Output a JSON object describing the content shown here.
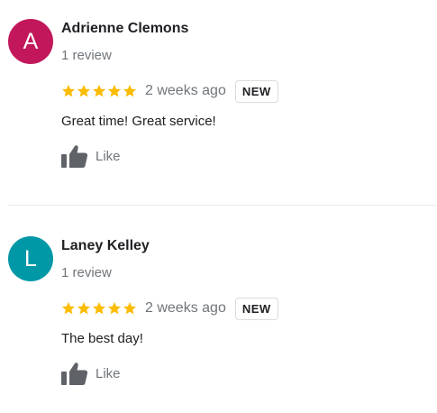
{
  "reviews": [
    {
      "avatar_letter": "A",
      "avatar_color": "#c2185b",
      "name": "Adrienne Clemons",
      "review_count": "1 review",
      "rating": 5,
      "time": "2 weeks ago",
      "badge": "NEW",
      "text": "Great time! Great service!",
      "like_label": "Like"
    },
    {
      "avatar_letter": "L",
      "avatar_color": "#0097a7",
      "name": "Laney Kelley",
      "review_count": "1 review",
      "rating": 5,
      "time": "2 weeks ago",
      "badge": "NEW",
      "text": "The best day!",
      "like_label": "Like"
    }
  ],
  "colors": {
    "star": "#fbbc04",
    "icon": "#5f6368",
    "muted_text": "#70757a"
  },
  "icons": {
    "star": "star-icon",
    "like": "thumbs-up-icon"
  }
}
